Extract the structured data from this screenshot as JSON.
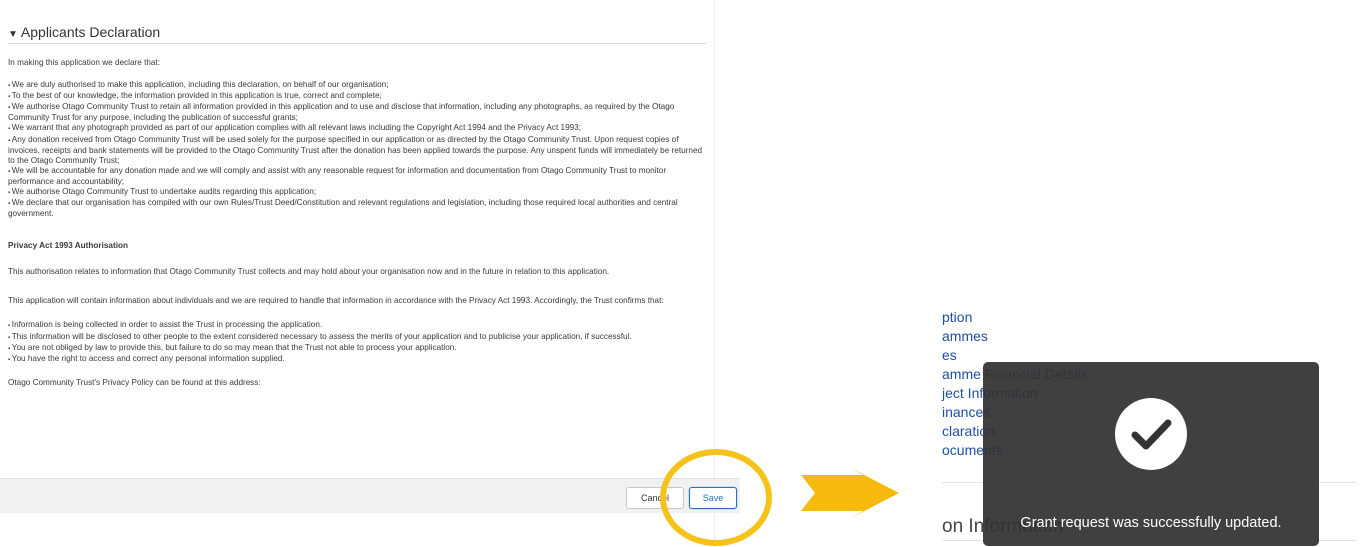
{
  "left": {
    "section_title": "Applicants Declaration",
    "intro": "In making this application we declare that:",
    "declarations": [
      "We are duly authorised to make this application, including this declaration, on behalf of our organisation;",
      "To the best of our knowledge, the information provided in this application is true, correct and complete;",
      "We authorise Otago Community Trust to retain all information provided in this application and to use and disclose that information, including any photographs, as required by the Otago Community Trust for any purpose, including the publication of successful grants;",
      "We warrant that any photograph provided as part of our application complies with all relevant laws including the Copyright Act 1994 and the Privacy Act 1993;",
      "Any donation received from Otago Community Trust will be used solely for the purpose specified in our application or as directed by the Otago Community Trust. Upon request copies of invoices, receipts and bank statements will be provided to the Otago Community Trust after the donation has been applied towards the purpose. Any unspent funds will immediately be returned to the Otago Community Trust;",
      "We will be accountable for any donation made and we will comply and assist with any reasonable request for information and documentation from Otago Community Trust to monitor performance and accountability;",
      "We authorise Otago Community Trust to undertake audits regarding this application;",
      "We declare that our organisation has compiled with our own Rules/Trust Deed/Constitution and relevant regulations and legislation, including those required local authorities and central government."
    ],
    "privacy_heading": "Privacy Act 1993 Authorisation",
    "privacy_para1": "This authorisation relates to information that Otago Community Trust collects and may hold about your organisation now and in the future in relation to this application.",
    "privacy_para2": "This application will contain information about individuals and we are required to handle that information in accordance with the Privacy Act 1993. Accordingly, the Trust confirms that:",
    "privacy_points": [
      "Information is being collected in order to assist the Trust in processing the application.",
      "This information will be disclosed to other people to the extent considered necessary to assess the merits of your application and to publicise your application, if successful.",
      "You are not obliged by law to provide this, but failure to do so may mean that the Trust not able to process your application.",
      "You have the right to access and correct any personal information supplied."
    ],
    "policy_line": "Otago Community Trust's Privacy Policy can be found at this address:",
    "cancel_label": "Cancel",
    "save_label": "Save"
  },
  "right": {
    "nav_fragments": [
      "ption",
      "ammes",
      "es",
      "amme Financial Details",
      "ject Information",
      "inances",
      "claration",
      "ocuments"
    ],
    "bg_heading": "on Information"
  },
  "toast": {
    "message": "Grant request was successfully updated."
  },
  "colors": {
    "highlight": "#f6c31b",
    "arrow": "#f6b90e",
    "link": "#1f4fa1",
    "toast_bg": "#323232"
  },
  "icons": [
    "collapse-triangle-icon",
    "checkmark-icon",
    "arrow-right-icon"
  ]
}
